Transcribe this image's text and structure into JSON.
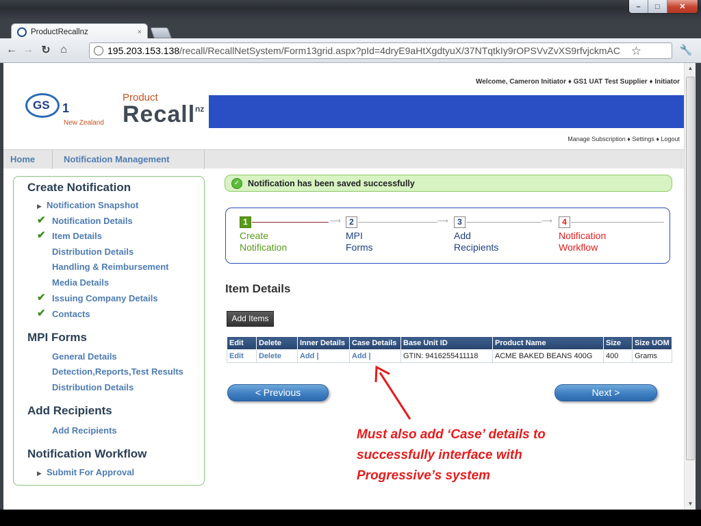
{
  "browser": {
    "tab_title": "ProductRecallnz",
    "tab_close": "×",
    "url_host": "195.203.153.138",
    "url_path": "/recall/RecallNetSystem/Form13grid.aspx?pId=4dryE9aHtXgdtyuX/37NTqtkIy9rOPSVvZvXS9rfvjckmAC"
  },
  "header": {
    "welcome": "Welcome, Cameron Initiator  ♦  GS1 UAT Test Supplier  ♦  Initiator",
    "logo_gs": "GS",
    "logo_1": "1",
    "logo_nz": "New Zealand",
    "logo_product": "Product",
    "logo_recall": "Recall",
    "logo_recall_nz": "nz",
    "util_links": "Manage Subscription  ♦  Settings  ♦  Logout"
  },
  "nav": {
    "home": "Home",
    "notification_mgmt": "Notification Management"
  },
  "sidebar": {
    "h_create": "Create Notification",
    "notification_snapshot": "Notification Snapshot",
    "notification_details": "Notification Details",
    "item_details": "Item Details",
    "distribution_details": "Distribution Details",
    "handling": "Handling & Reimbursement",
    "media": "Media Details",
    "issuing": "Issuing Company Details",
    "contacts": "Contacts",
    "h_mpi": "MPI Forms",
    "general": "General Details",
    "detection": "Detection,Reports,Test Results",
    "mpi_distribution": "Distribution Details",
    "h_add": "Add Recipients",
    "add_recipients": "Add Recipients",
    "h_workflow": "Notification Workflow",
    "submit": "Submit For Approval"
  },
  "banner": {
    "message": "Notification has been saved successfully"
  },
  "steps": [
    {
      "num": "1",
      "line1": "Create",
      "line2": "Notification"
    },
    {
      "num": "2",
      "line1": "MPI",
      "line2": "Forms"
    },
    {
      "num": "3",
      "line1": "Add",
      "line2": "Recipients"
    },
    {
      "num": "4",
      "line1": "Notification",
      "line2": "Workflow"
    }
  ],
  "item_section": {
    "title": "Item Details",
    "add_button": "Add Items"
  },
  "grid": {
    "headers": [
      "Edit",
      "Delete",
      "Inner Details",
      "Case Details",
      "Base Unit ID",
      "Product Name",
      "Size",
      "Size UOM"
    ],
    "row": [
      "Edit",
      "Delete",
      "Add |",
      "Add |",
      "GTIN: 9416255411118",
      "ACME BAKED BEANS 400G",
      "400",
      "Grams"
    ]
  },
  "buttons": {
    "previous": "< Previous",
    "next": "Next >"
  },
  "annotation": {
    "line1": "Must also add ‘Case’ details to",
    "line2": "successfully interface with",
    "line3": "Progressive’s system"
  },
  "colors": {
    "accent_blue": "#2a4fc4",
    "step_active": "#5a9a1a",
    "step_alert": "#e51c1c",
    "annotation": "#e51c1c"
  }
}
